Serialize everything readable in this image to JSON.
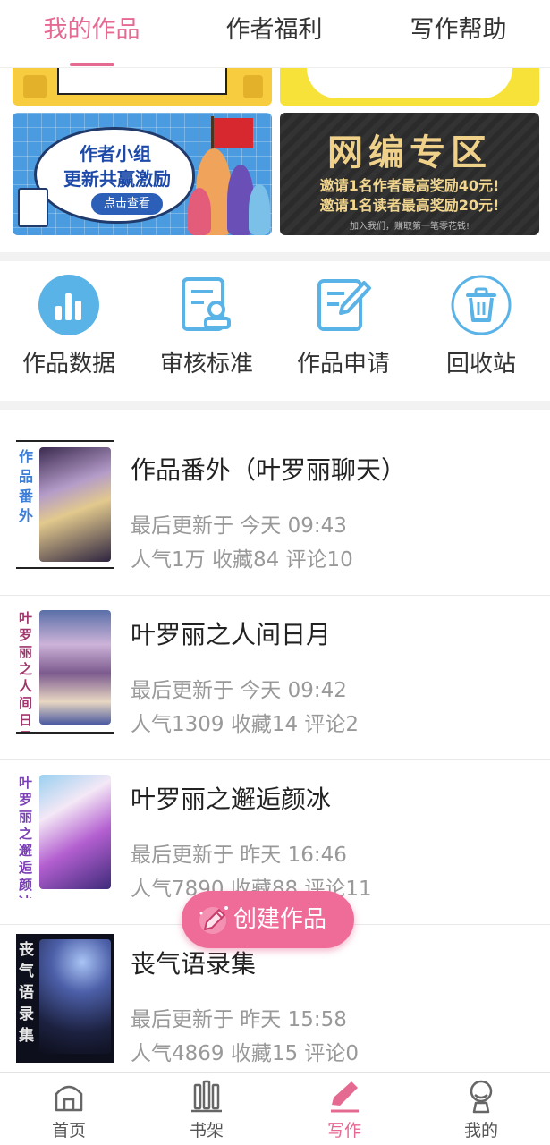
{
  "top_tabs": [
    {
      "label": "我的作品",
      "active": true
    },
    {
      "label": "作者福利",
      "active": false
    },
    {
      "label": "写作帮助",
      "active": false
    }
  ],
  "banners": {
    "group": {
      "line1": "作者小组",
      "line2": "更新共赢激励",
      "button": "点击查看"
    },
    "network": {
      "title": "网编专区",
      "line1": "邀请1名作者最高奖励40元!",
      "line2": "邀请1名读者最高奖励20元!",
      "footer": "加入我们，赚取第一笔零花钱!"
    }
  },
  "quick_actions": [
    {
      "label": "作品数据",
      "icon": "bar-chart-icon"
    },
    {
      "label": "审核标准",
      "icon": "review-doc-icon"
    },
    {
      "label": "作品申请",
      "icon": "edit-doc-icon"
    },
    {
      "label": "回收站",
      "icon": "trash-icon"
    }
  ],
  "works": [
    {
      "title": "作品番外（叶罗丽聊天）",
      "cover_text": "作品番外",
      "updated": "最后更新于 今天 09:43",
      "stats": "人气1万 收藏84 评论10"
    },
    {
      "title": "叶罗丽之人间日月",
      "cover_text": "叶罗丽之人间日月",
      "updated": "最后更新于 今天 09:42",
      "stats": "人气1309 收藏14 评论2"
    },
    {
      "title": "叶罗丽之邂逅颜冰",
      "cover_text": "叶罗丽之邂逅颜冰",
      "updated": "最后更新于 昨天 16:46",
      "stats": "人气7890 收藏88 评论11"
    },
    {
      "title": "丧气语录集",
      "cover_text": "丧气语录集",
      "updated": "最后更新于 昨天 15:58",
      "stats": "人气4869 收藏15 评论0"
    }
  ],
  "fab": {
    "label": "创建作品"
  },
  "bottom_nav": [
    {
      "label": "首页",
      "icon": "home-icon",
      "active": false
    },
    {
      "label": "书架",
      "icon": "bookshelf-icon",
      "active": false
    },
    {
      "label": "写作",
      "icon": "pen-icon",
      "active": true
    },
    {
      "label": "我的",
      "icon": "profile-icon",
      "active": false
    }
  ],
  "colors": {
    "accent": "#e56a92",
    "fab": "#f06c98",
    "action_blue": "#5ab3e6",
    "muted_text": "#999999"
  }
}
